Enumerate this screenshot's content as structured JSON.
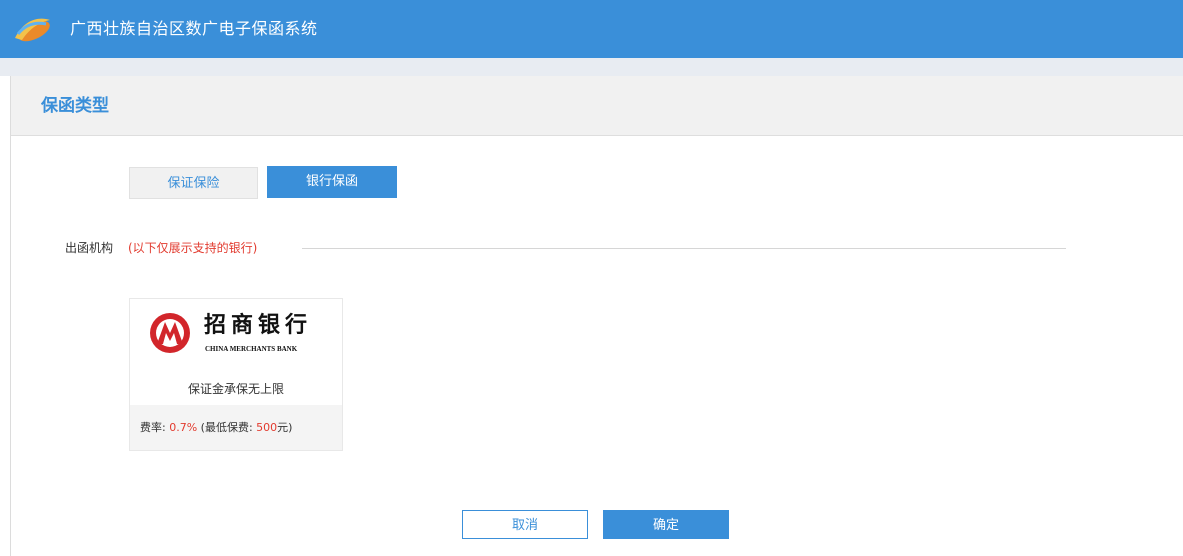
{
  "header": {
    "app_title": "广西壮族自治区数广电子保函系统",
    "logo_icon": "app-logo-icon"
  },
  "section": {
    "title": "保函类型"
  },
  "tabs": [
    {
      "label": "保证保险",
      "active": false
    },
    {
      "label": "银行保函",
      "active": true
    }
  ],
  "issuer": {
    "label": "出函机构",
    "note": "(以下仅展示支持的银行)"
  },
  "banks": [
    {
      "name_cn": "招商银行",
      "name_en": "CHINA MERCHANTS BANK",
      "logo_icon": "cmb-logo-icon",
      "description": "保证金承保无上限",
      "fee_label": "费率:",
      "fee_rate": "0.7%",
      "min_fee_open": "(最低保费:",
      "min_fee_value": "500",
      "min_fee_close": "元)"
    }
  ],
  "actions": {
    "cancel_label": "取消",
    "confirm_label": "确定"
  },
  "colors": {
    "primary": "#3a8fd9",
    "accent_red": "#e23b2f"
  }
}
